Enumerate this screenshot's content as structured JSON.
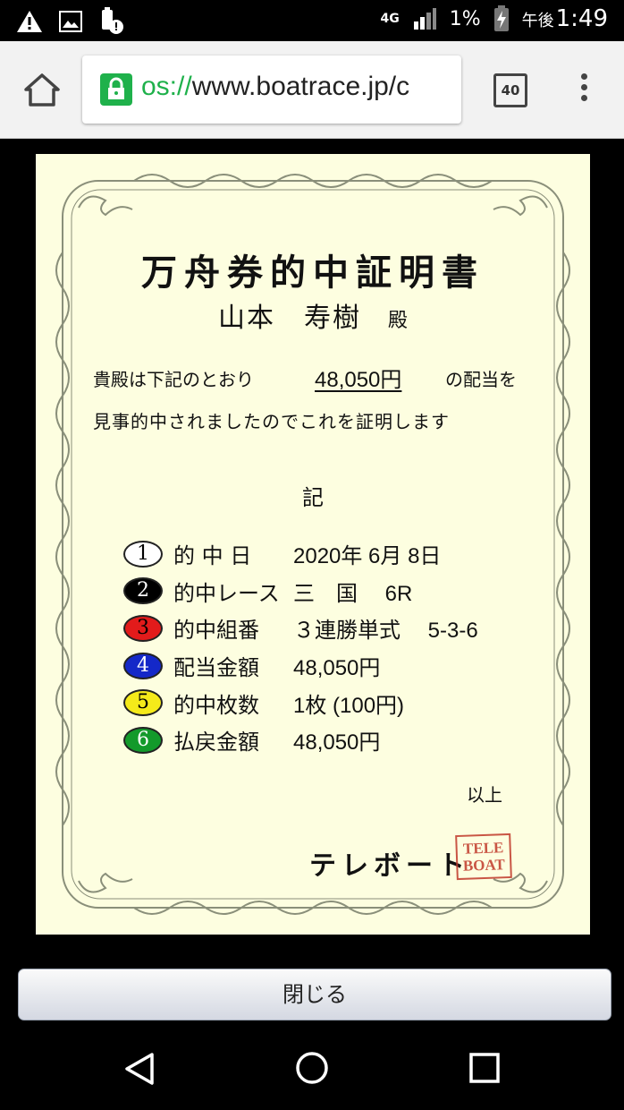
{
  "status_bar": {
    "network": "4G",
    "battery": "1%",
    "time_prefix": "午後",
    "time": "1:49",
    "icons": [
      "warning-icon",
      "image-icon",
      "battery-alert-icon",
      "signal-icon",
      "charging-icon"
    ]
  },
  "browser": {
    "url_scheme_visible": "os://",
    "url_rest": "www.boatrace.jp/c",
    "tab_count": "40",
    "secure": true
  },
  "certificate": {
    "title": "万舟券的中証明書",
    "recipient_name": "山本　寿樹",
    "recipient_honorific": "殿",
    "line1_before": "貴殿は下記のとおり",
    "line1_amount": "48,050円",
    "line1_after": "の配当を",
    "line2": "見事的中されましたのでこれを証明します",
    "ki": "記",
    "items": [
      {
        "num": "1",
        "label": "的 中 日",
        "value": "2020年 6月 8日",
        "color": "#ffffff"
      },
      {
        "num": "2",
        "label": "的中レース",
        "value": "三　国　 6R",
        "color": "#000000"
      },
      {
        "num": "3",
        "label": "的中組番",
        "value": "３連勝単式　 5-3-6",
        "color": "#e21b1b"
      },
      {
        "num": "4",
        "label": "配当金額",
        "value": "48,050円",
        "color": "#1428c8"
      },
      {
        "num": "5",
        "label": "的中枚数",
        "value": "1枚 (100円)",
        "color": "#f5ea1a"
      },
      {
        "num": "6",
        "label": "払戻金額",
        "value": "48,050円",
        "color": "#139a2b"
      }
    ],
    "ijo": "以上",
    "issuer": "テレボート",
    "stamp_line1": "TELE",
    "stamp_line2": "BOAT"
  },
  "close_button": {
    "label": "閉じる"
  },
  "nav": {
    "icons": [
      "back-icon",
      "home-circle-icon",
      "recents-icon"
    ]
  }
}
